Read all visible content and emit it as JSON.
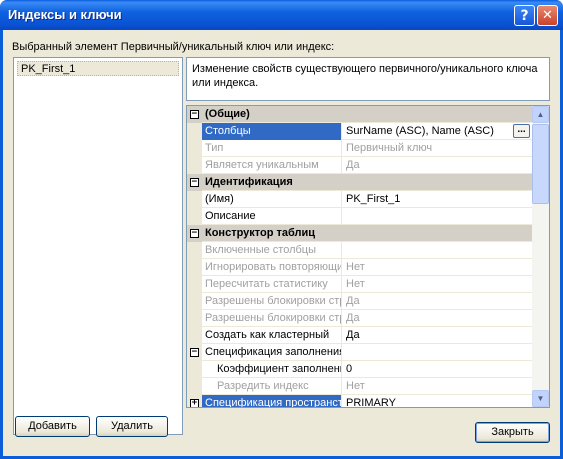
{
  "window": {
    "title": "Индексы и ключи",
    "help_glyph": "?",
    "close_glyph": "✕"
  },
  "selected_label": "Выбранный элемент Первичный/уникальный ключ или индекс:",
  "list": {
    "items": [
      {
        "label": "PK_First_1"
      }
    ]
  },
  "description": "Изменение свойств существующего первичного/уникального ключа или индекса.",
  "grid": {
    "rows": [
      {
        "name": "(Общие)"
      },
      {
        "name": "Столбцы",
        "value": "SurName (ASC), Name (ASC)",
        "button": "..."
      },
      {
        "name": "Тип",
        "value": "Первичный ключ"
      },
      {
        "name": "Является уникальным",
        "value": "Да"
      },
      {
        "name": "Идентификация"
      },
      {
        "name": "(Имя)",
        "value": "PK_First_1"
      },
      {
        "name": "Описание",
        "value": ""
      },
      {
        "name": "Конструктор таблиц"
      },
      {
        "name": "Включенные столбцы",
        "value": ""
      },
      {
        "name": "Игнорировать повторяющиеся",
        "value": "Нет"
      },
      {
        "name": "Пересчитать статистику",
        "value": "Нет"
      },
      {
        "name": "Разрешены блокировки строк",
        "value": "Да"
      },
      {
        "name": "Разрешены блокировки страниц",
        "value": "Да"
      },
      {
        "name": "Создать как кластерный",
        "value": "Да"
      },
      {
        "name": "Спецификация заполнения",
        "value": ""
      },
      {
        "name": "Коэффициент заполнения",
        "value": "0"
      },
      {
        "name": "Разредить индекс",
        "value": "Нет"
      },
      {
        "name": "Спецификация пространства данных",
        "value": "PRIMARY"
      }
    ]
  },
  "buttons": {
    "add": "Добавить",
    "delete": "Удалить",
    "close": "Закрыть"
  }
}
